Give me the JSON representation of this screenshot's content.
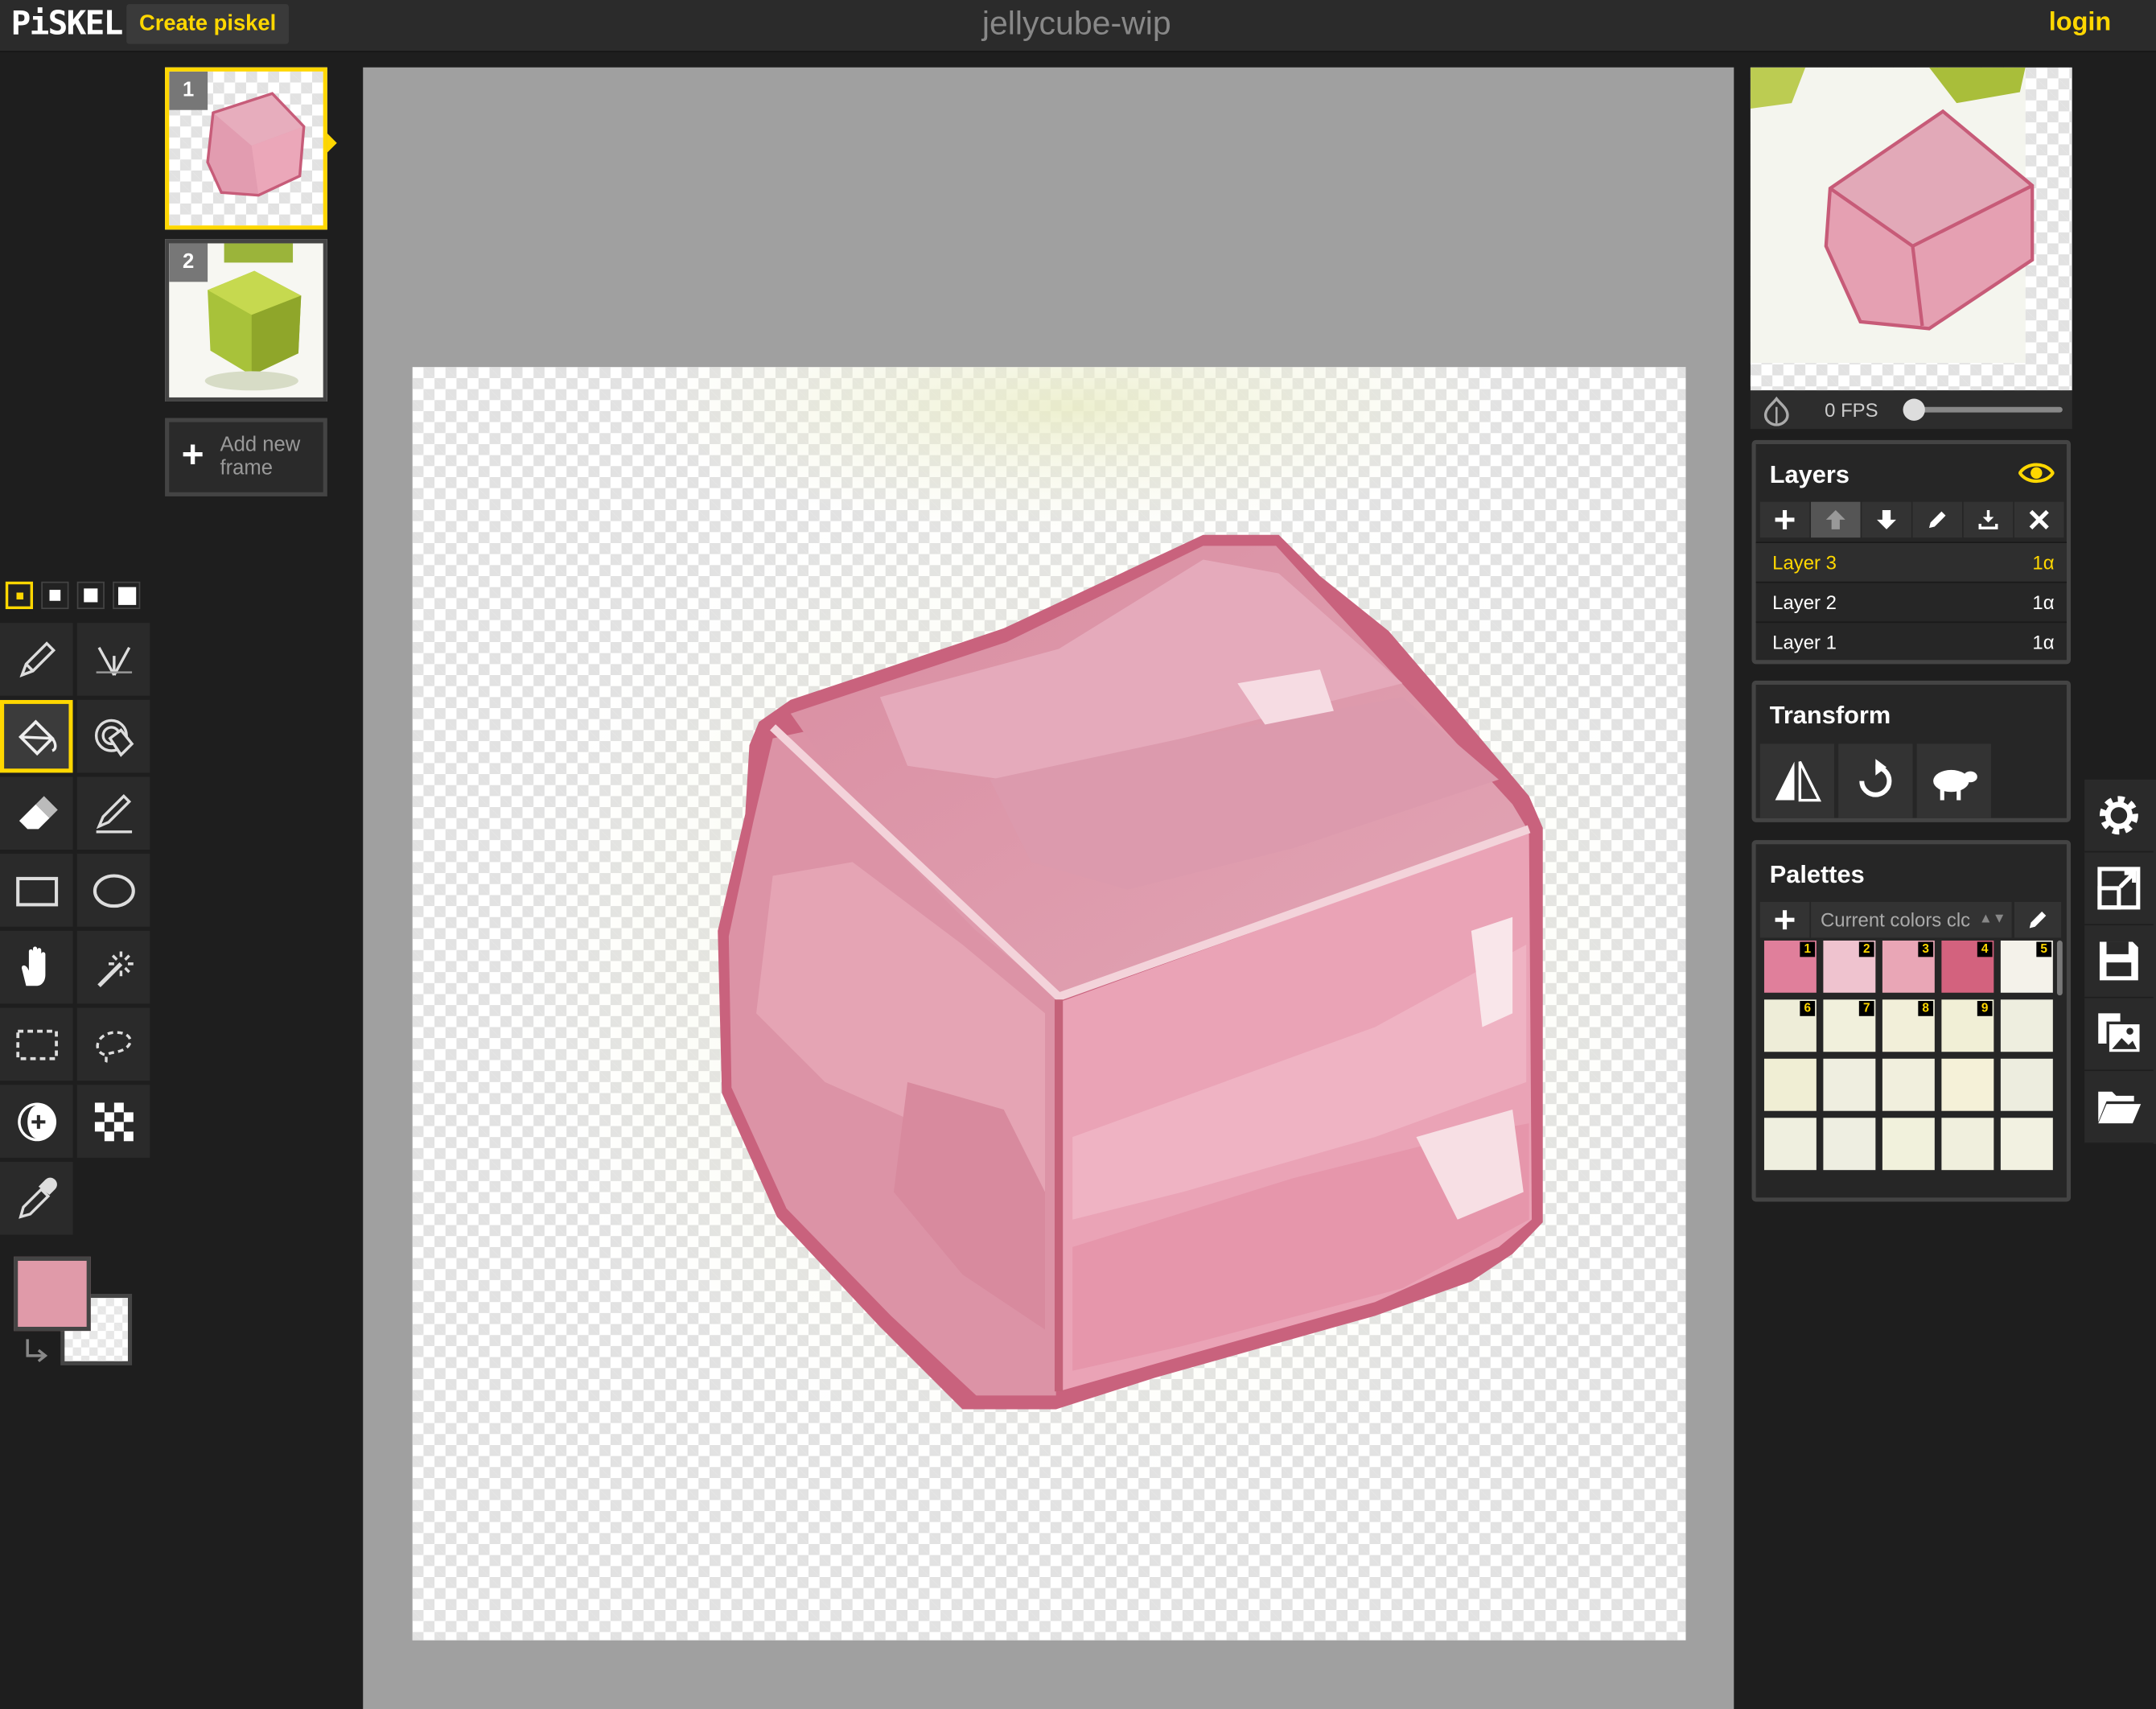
{
  "app": {
    "logo": "PiSKEL",
    "create_label": "Create piskel",
    "title": "jellycube-wip",
    "login_label": "login"
  },
  "frames": [
    {
      "number": "1",
      "selected": true
    },
    {
      "number": "2",
      "selected": false
    }
  ],
  "add_frame": {
    "line1": "Add new",
    "line2": "frame"
  },
  "pen_sizes": [
    1,
    2,
    3,
    4
  ],
  "tools": [
    "pen-tool",
    "vertical-mirror-pen-tool",
    "paint-bucket-tool",
    "paint-all-same-color-tool",
    "eraser-tool",
    "stroke-tool",
    "rectangle-tool",
    "circle-tool",
    "move-tool",
    "shape-selection-tool",
    "rectangle-selection-tool",
    "lasso-selection-tool",
    "lighten-tool",
    "dithering-tool",
    "color-picker-tool"
  ],
  "colors": {
    "primary": "#e09aa9",
    "secondary": "transparent",
    "accent": "#ffd700"
  },
  "preview": {
    "fps_label": "0 FPS",
    "fps_value": 0
  },
  "layers": {
    "title": "Layers",
    "items": [
      {
        "name": "Layer 3",
        "opacity": "1α",
        "active": true
      },
      {
        "name": "Layer 2",
        "opacity": "1α",
        "active": false
      },
      {
        "name": "Layer 1",
        "opacity": "1α",
        "active": false
      }
    ]
  },
  "transform": {
    "title": "Transform"
  },
  "palettes": {
    "title": "Palettes",
    "selected": "Current colors clc",
    "swatches": [
      {
        "color": "#e07f9b",
        "label": "1"
      },
      {
        "color": "#efc3cf",
        "label": "2"
      },
      {
        "color": "#e9a6b6",
        "label": "3"
      },
      {
        "color": "#d3627e",
        "label": "4"
      },
      {
        "color": "#f4f2ea",
        "label": "5"
      },
      {
        "color": "#eeedd8",
        "label": "6"
      },
      {
        "color": "#f1f0dc",
        "label": "7"
      },
      {
        "color": "#f2efd9",
        "label": "8"
      },
      {
        "color": "#f1efd6",
        "label": "9"
      },
      {
        "color": "#eeeedf",
        "label": ""
      },
      {
        "color": "#f0eed4",
        "label": ""
      },
      {
        "color": "#efeee0",
        "label": ""
      },
      {
        "color": "#f1efdd",
        "label": ""
      },
      {
        "color": "#f5f1d8",
        "label": ""
      },
      {
        "color": "#ededdf",
        "label": ""
      },
      {
        "color": "#efefdf",
        "label": ""
      },
      {
        "color": "#eeeee1",
        "label": ""
      },
      {
        "color": "#f1f1dc",
        "label": ""
      },
      {
        "color": "#f0efdd",
        "label": ""
      },
      {
        "color": "#f2f1e1",
        "label": ""
      }
    ]
  },
  "side_buttons": [
    "settings-icon",
    "resize-icon",
    "save-icon",
    "export-image-icon",
    "open-folder-icon"
  ]
}
